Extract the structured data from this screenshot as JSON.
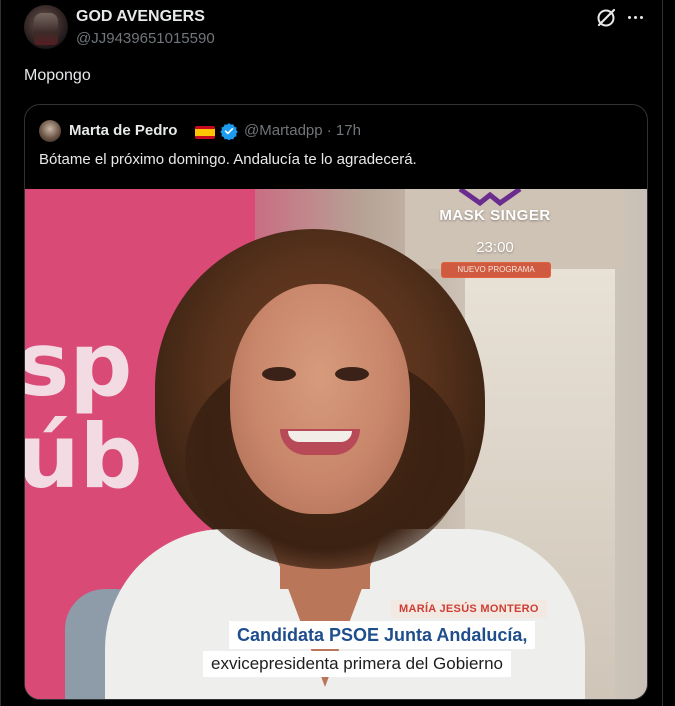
{
  "tweet": {
    "author_name": "GOD AVENGERS",
    "author_handle": "@JJ9439651015590",
    "text": "Mopongo"
  },
  "quote": {
    "author_name": "Marta de Pedro",
    "author_handle": "@Martadpp · 17h",
    "text": "Bótame el próximo domingo. Andalucía te lo agradecerá.",
    "media": {
      "background_text": "sp\núb",
      "show_title": "MASK SINGER",
      "show_time": "23:00",
      "show_badge": "NUEVO PROGRAMA",
      "caption_name": "MARÍA JESÚS MONTERO",
      "caption_line1": "Candidata PSOE Junta Andalucía,",
      "caption_line2": "exvicepresidenta primera del Gobierno"
    }
  },
  "icons": {
    "grok": "grok-icon",
    "more": "more-icon",
    "verified": "verified-icon",
    "flag": "spain-flag-icon"
  },
  "colors": {
    "background": "#000000",
    "text_primary": "#e7e9ea",
    "text_secondary": "#71767b",
    "border": "#2f3336",
    "verified_blue": "#1d9bf0"
  }
}
